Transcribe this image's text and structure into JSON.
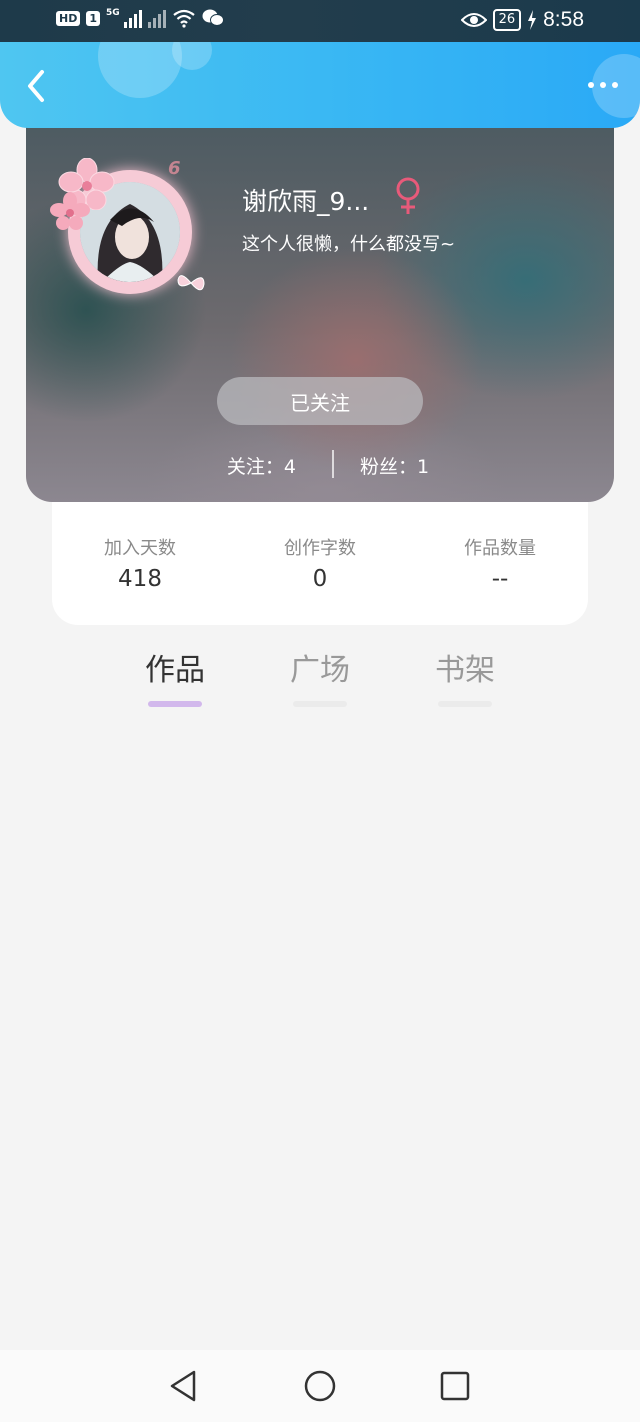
{
  "status_bar": {
    "hd": "HD",
    "sim_slot": "1",
    "network": "5G",
    "battery": "26",
    "time": "8:58"
  },
  "header": {
    "back_icon": "chevron-left-icon",
    "more_icon": "more-dots-icon"
  },
  "profile": {
    "username": "谢欣雨_9...",
    "gender_icon": "female-symbol-icon",
    "gender_color": "#e85a7a",
    "level": "6",
    "bio": "这个人很懒，什么都没写~",
    "follow_button": "已关注",
    "following": "关注：4",
    "followers": "粉丝：1"
  },
  "stats": [
    {
      "label": "加入天数",
      "value": "418"
    },
    {
      "label": "创作字数",
      "value": "0"
    },
    {
      "label": "作品数量",
      "value": "--"
    }
  ],
  "tabs": [
    {
      "label": "作品",
      "active": true
    },
    {
      "label": "广场",
      "active": false
    },
    {
      "label": "书架",
      "active": false
    }
  ],
  "colors": {
    "header_accent": "#3ab8f3",
    "tab_active_text": "#333333",
    "tab_inactive_text": "#999999",
    "tab_active_underline": "#d2b8ec",
    "tab_inactive_underline": "#ebebeb"
  },
  "nav_bar": {
    "back_icon": "triangle-back-icon",
    "home_icon": "circle-home-icon",
    "recents_icon": "square-recents-icon"
  }
}
